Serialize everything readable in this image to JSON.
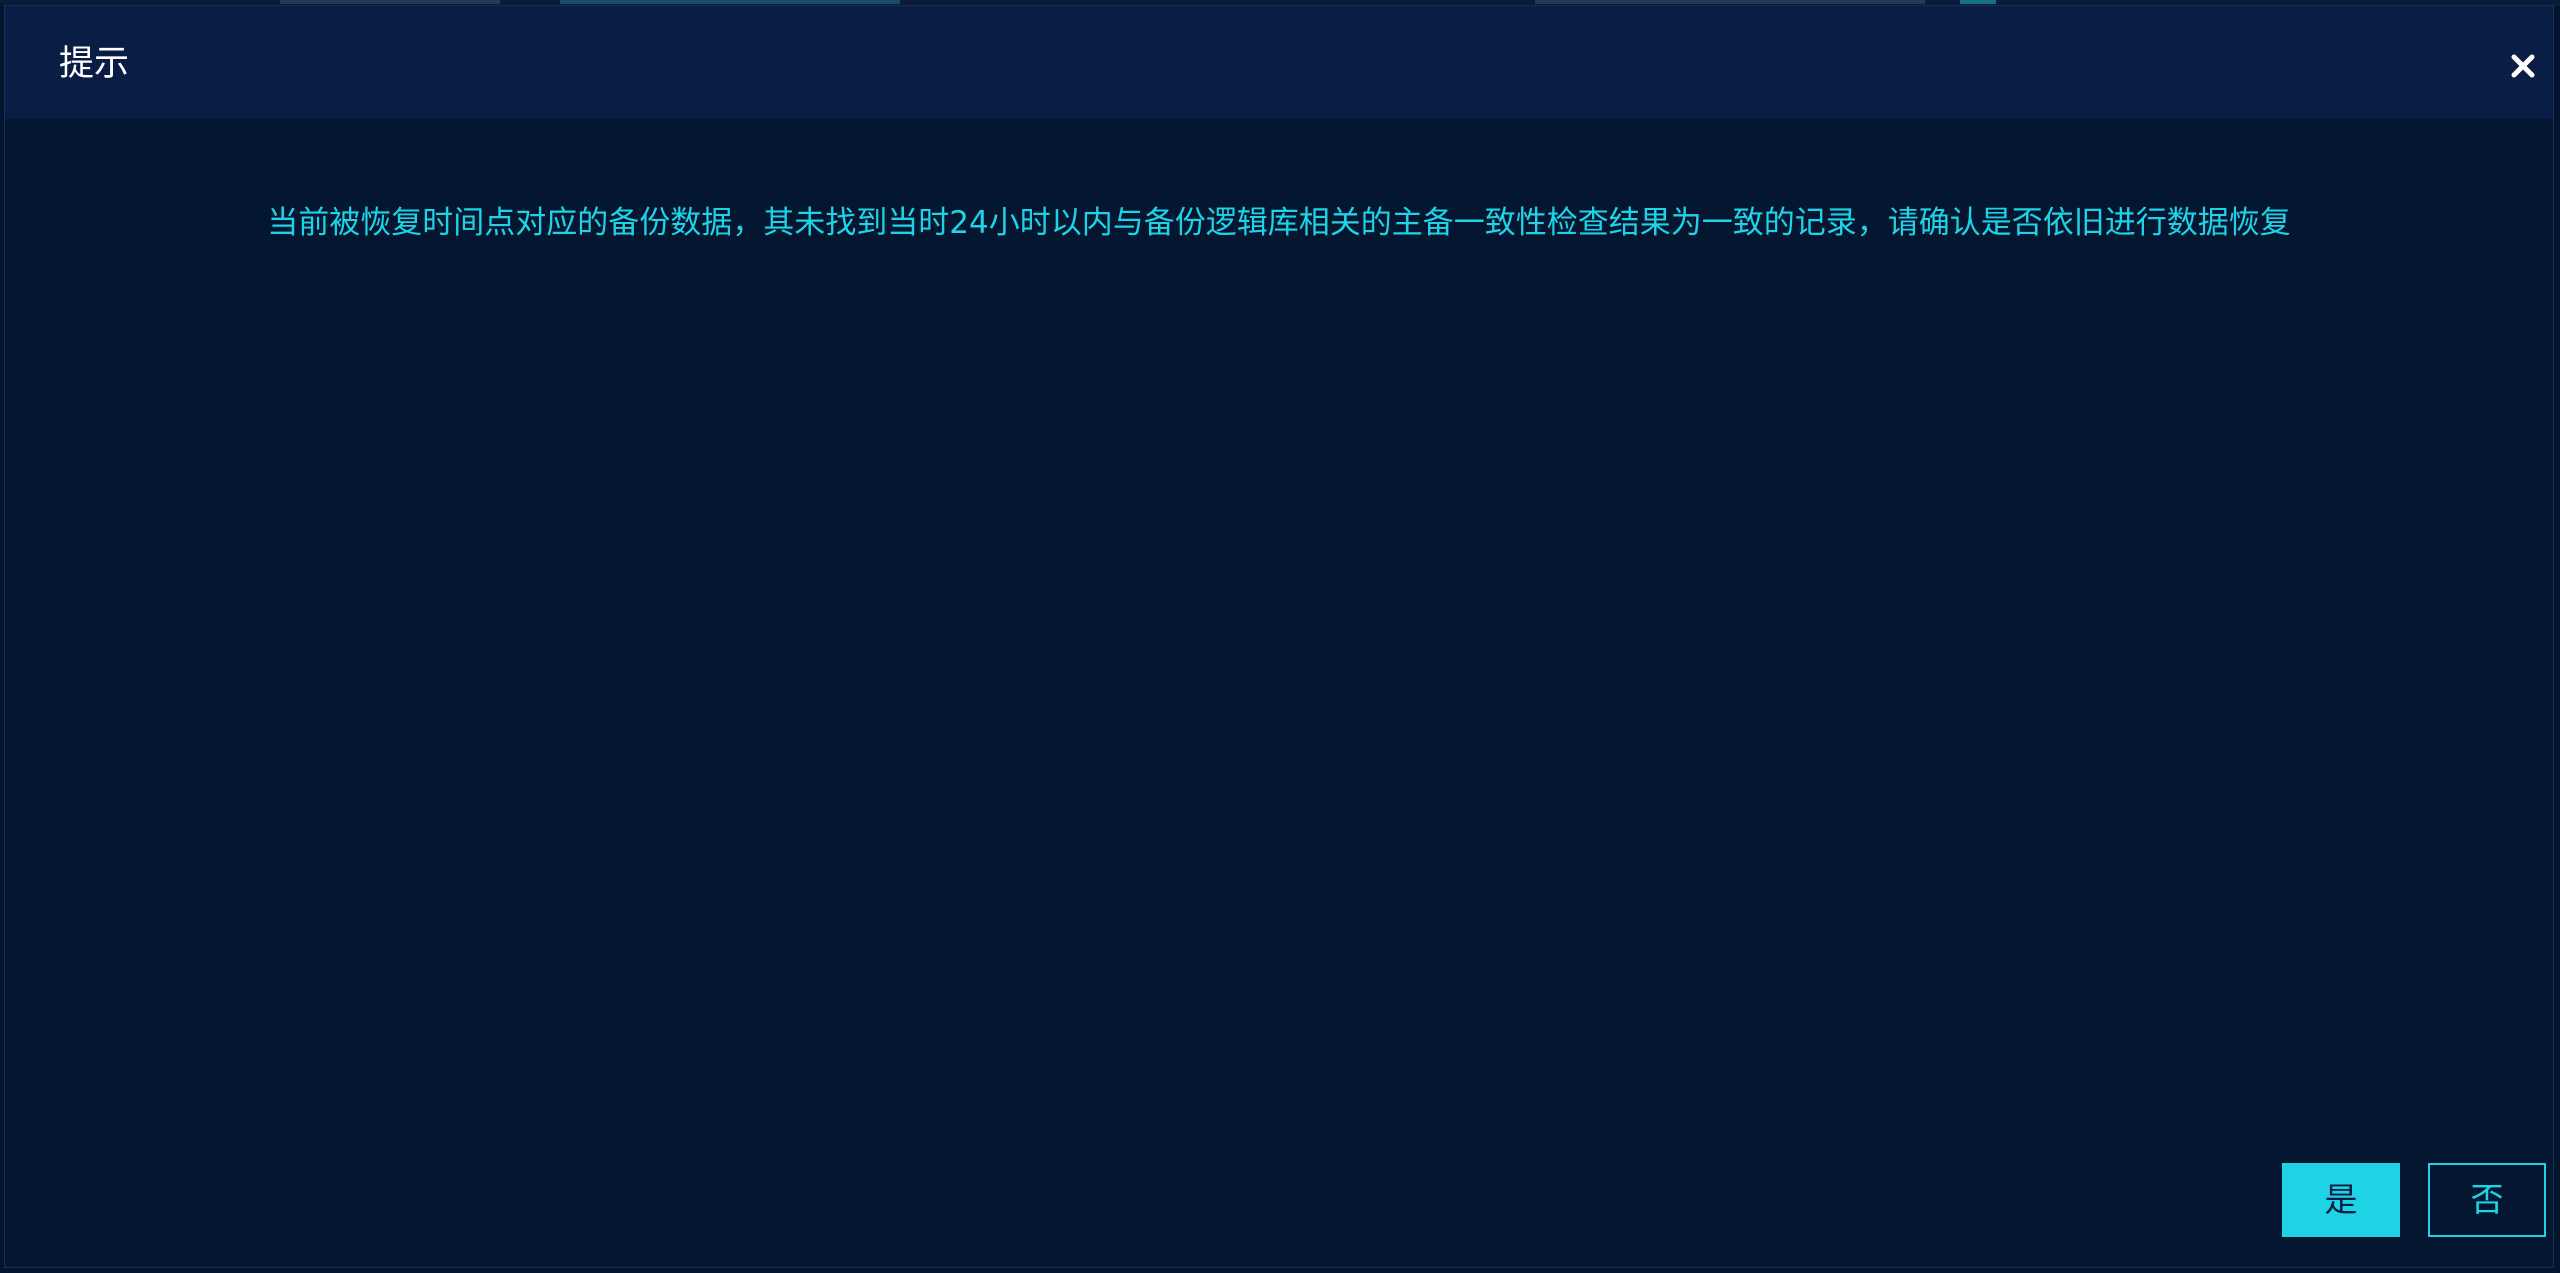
{
  "dialog": {
    "title": "提示",
    "close_icon": "close-icon",
    "message": "当前被恢复时间点对应的备份数据，其未找到当时24小时以内与备份逻辑库相关的主备一致性检查结果为一致的记录，请确认是否依旧进行数据恢复",
    "buttons": {
      "yes_label": "是",
      "no_label": "否"
    }
  },
  "colors": {
    "accent": "#1fd3e6",
    "header_bg": "#0a1d44",
    "body_bg": "#051631",
    "page_bg": "#04142e",
    "title_text": "#ffffff"
  }
}
